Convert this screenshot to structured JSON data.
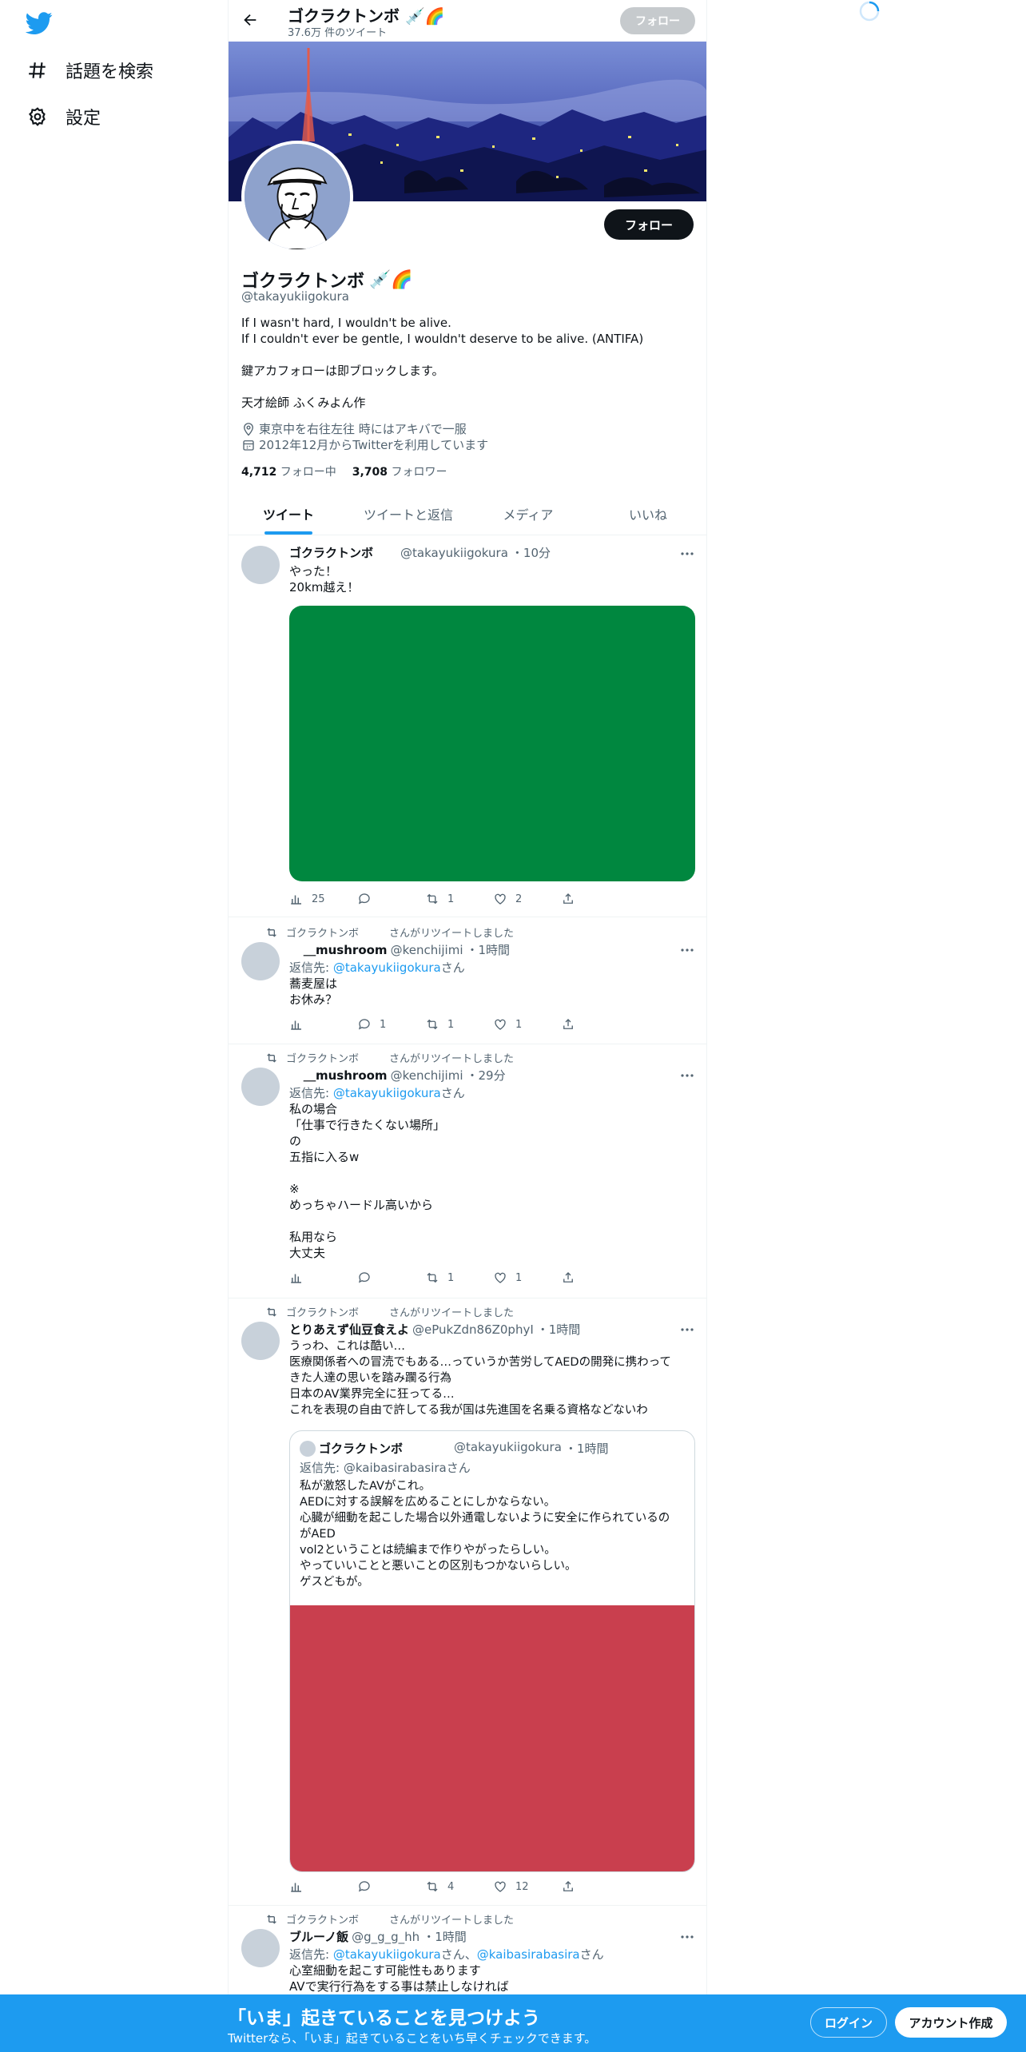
{
  "nav": {
    "items": [
      {
        "label": "話題を検索",
        "icon": "hashtag-icon"
      },
      {
        "label": "設定",
        "icon": "gear-icon"
      }
    ]
  },
  "header": {
    "name": "ゴクラクトンボ",
    "tweet_count": "37.6万 件のツイート",
    "follow_label": "フォロー"
  },
  "profile": {
    "name": "ゴクラクトンボ",
    "handle": "@takayukiigokura",
    "follow_label": "フォロー",
    "bio": [
      "If I wasn't hard, I wouldn't be alive.",
      "If I couldn't ever be gentle, I wouldn't deserve to be alive. (ANTIFA)",
      "",
      "鍵アカフォローは即ブロックします。",
      "",
      "天才絵師 ふくみよん作"
    ],
    "location": "東京中を右往左往 時にはアキバで一服",
    "joined": "2012年12月からTwitterを利用しています",
    "following_count": "4,712",
    "following_label": "フォロー中",
    "followers_count": "3,708",
    "followers_label": "フォロワー"
  },
  "tabs": [
    "ツイート",
    "ツイートと返信",
    "メディア",
    "いいね"
  ],
  "tweets": [
    {
      "name": "ゴクラクトンボ",
      "handle": "@takayukiigokura",
      "time": "・10分",
      "lines": [
        "やった！",
        "20km越え！"
      ],
      "media_color": "#00873f",
      "views": "25",
      "replies": "",
      "retweets": "1",
      "likes": "2"
    },
    {
      "retweeter": "ゴクラクトンボ",
      "retweet_label": "さんがリツイートしました",
      "name": "＿mushroom",
      "handle": "@kenchijimi",
      "time": "・1時間",
      "reply_prefix": "返信先: ",
      "reply_to": "@takayukiigokura",
      "reply_suffix": "さん",
      "lines": [
        "蕎麦屋は",
        "お休み？"
      ],
      "views": "",
      "replies": "1",
      "retweets": "1",
      "likes": "1"
    },
    {
      "retweeter": "ゴクラクトンボ",
      "retweet_label": "さんがリツイートしました",
      "name": "＿mushroom",
      "handle": "@kenchijimi",
      "time": "・29分",
      "reply_prefix": "返信先: ",
      "reply_to": "@takayukiigokura",
      "reply_suffix": "さん",
      "lines": [
        "私の場合",
        "「仕事で行きたくない場所」",
        "の",
        "五指に入るw",
        "",
        "※",
        "めっちゃハードル高いから",
        "",
        "私用なら",
        "大丈夫"
      ],
      "views": "",
      "replies": "",
      "retweets": "1",
      "likes": "1"
    },
    {
      "retweeter": "ゴクラクトンボ",
      "retweet_label": "さんがリツイートしました",
      "name": "とりあえず仙豆食えよ",
      "handle": "@ePukZdn86Z0phyI",
      "time": "・1時間",
      "lines": [
        "うっわ、これは酷い…",
        "医療関係者への冒涜でもある…っていうか苦労してAEDの開発に携わって",
        "きた人達の思いを踏み躙る行為",
        "日本のAV業界完全に狂ってる…",
        "これを表現の自由で許してる我が国は先進国を名乗る資格などないわ"
      ],
      "quote": {
        "name": "ゴクラクトンボ",
        "handle": "@takayukiigokura",
        "time": "・1時間",
        "reply_prefix": "返信先: ",
        "reply_to": "@kaibasirabasira",
        "reply_suffix": "さん",
        "lines": [
          "私が激怒したAVがこれ。",
          "AEDに対する誤解を広めることにしかならない。",
          "心臓が細動を起こした場合以外通電しないように安全に作られているの",
          "がAED",
          "vol2ということは続編まで作りやがったらしい。",
          "やっていいことと悪いことの区別もつかないらしい。",
          "ゲスどもが。"
        ],
        "media_color": "#c93f4e"
      },
      "views": "",
      "replies": "",
      "retweets": "4",
      "likes": "12"
    },
    {
      "retweeter": "ゴクラクトンボ",
      "retweet_label": "さんがリツイートしました",
      "name": "ブルーノ飯",
      "handle": "@g_g_g_hh",
      "time": "・1時間",
      "reply_prefix": "返信先: ",
      "reply_to": "@takayukiigokura",
      "reply_sep": "さん、",
      "reply_to2": "@kaibasirabasira",
      "reply_suffix": "さん",
      "lines": [
        "心室細動を起こす可能性もあります",
        "AVで実行行為をする事は禁止しなければ"
      ]
    }
  ],
  "bottom": {
    "title": "「いま」起きていることを見つけよう",
    "subtitle": "Twitterなら、「いま」起きていることをいち早くチェックできます。",
    "login": "ログイン",
    "signup": "アカウント作成"
  },
  "colors": {
    "accent": "#1d9bf0",
    "text": "#0f1419",
    "muted": "#536471"
  }
}
